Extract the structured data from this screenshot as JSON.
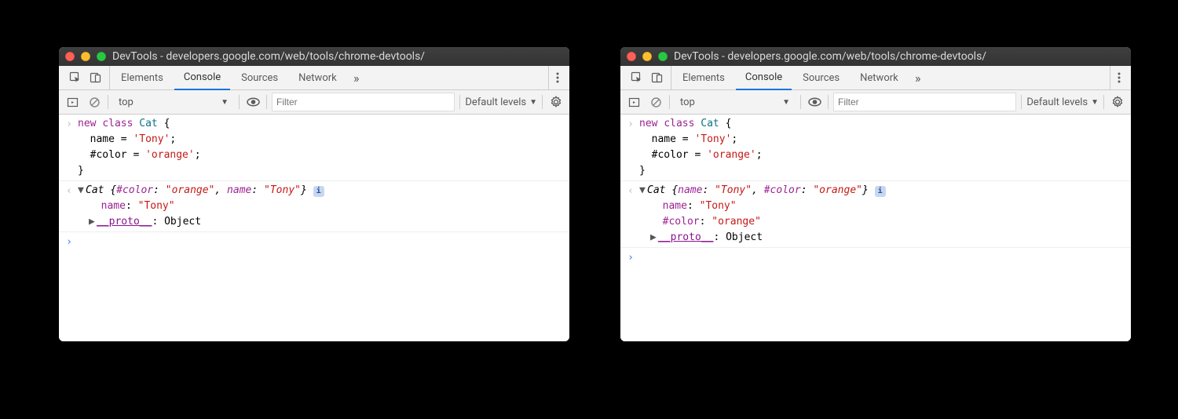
{
  "title": "DevTools - developers.google.com/web/tools/chrome-devtools/",
  "tabs": {
    "elements": "Elements",
    "console": "Console",
    "sources": "Sources",
    "network": "Network"
  },
  "toolbar": {
    "context": "top",
    "filter_placeholder": "Filter",
    "levels": "Default levels"
  },
  "code_input": "new class Cat {\n  name = 'Tony';\n  #color = 'orange';\n}",
  "left": {
    "obj_summary_pre": "Cat ",
    "obj_summary_open": "{",
    "obj_prop1_key": "#color",
    "obj_prop1_val": "\"orange\"",
    "obj_prop2_key": "name",
    "obj_prop2_val": "\"Tony\"",
    "obj_summary_close": "}",
    "expanded_name_key": "name",
    "expanded_name_val": "\"Tony\"",
    "proto_key": "__proto__",
    "proto_val": "Object"
  },
  "right": {
    "obj_summary_pre": "Cat ",
    "obj_summary_open": "{",
    "obj_prop1_key": "name",
    "obj_prop1_val": "\"Tony\"",
    "obj_prop2_key": "#color",
    "obj_prop2_val": "\"orange\"",
    "obj_summary_close": "}",
    "expanded_name_key": "name",
    "expanded_name_val": "\"Tony\"",
    "expanded_color_key": "#color",
    "expanded_color_val": "\"orange\"",
    "proto_key": "__proto__",
    "proto_val": "Object"
  }
}
